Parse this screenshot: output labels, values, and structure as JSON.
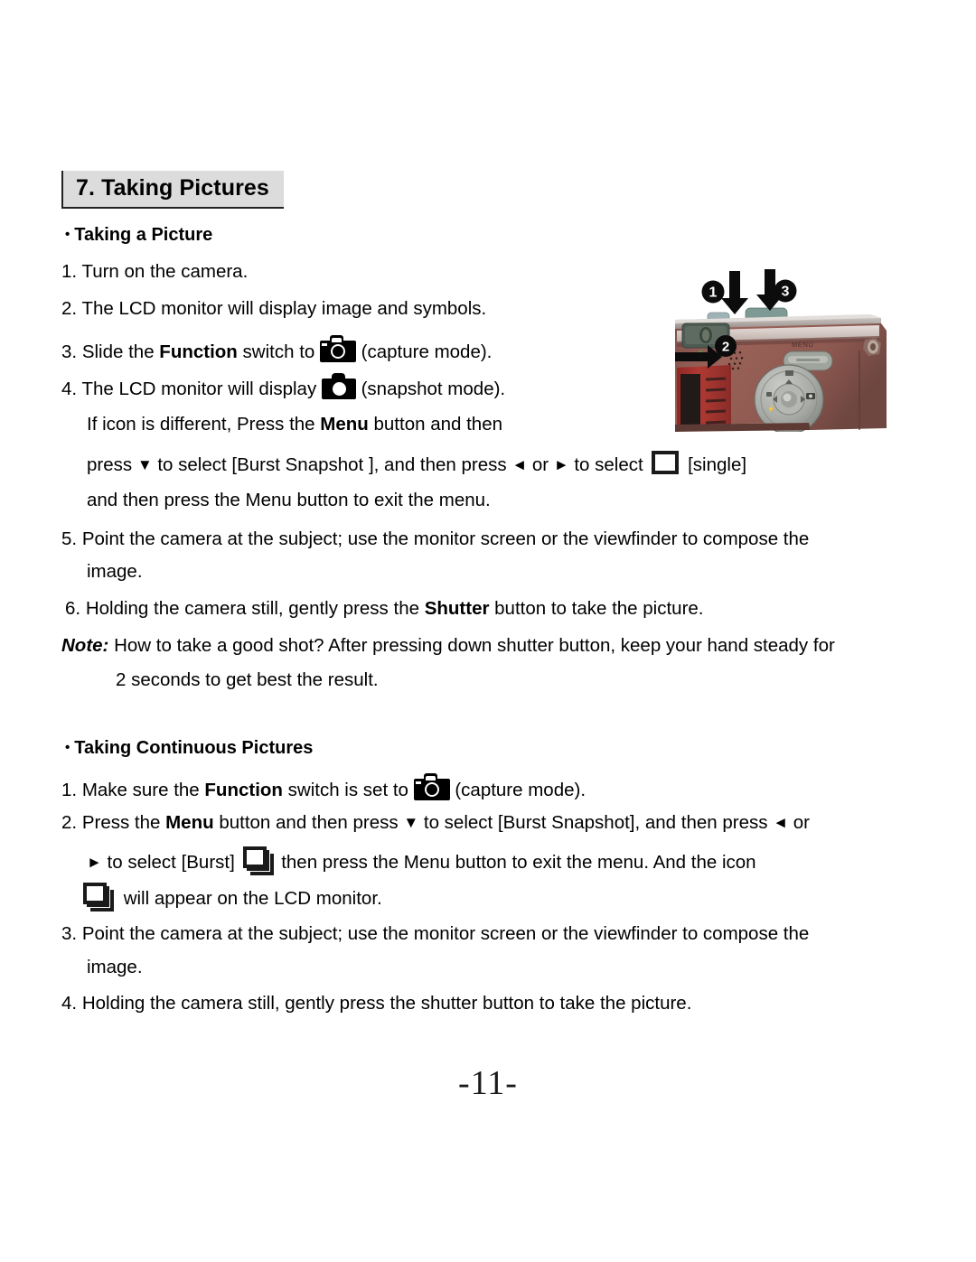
{
  "document": {
    "section_header": "7. Taking Pictures",
    "page_number": "-11-"
  },
  "sections": [
    {
      "heading": "Taking a Picture",
      "bullet": "•",
      "steps": [
        {
          "num": "1.",
          "text": "Turn on the camera."
        },
        {
          "num": "2.",
          "text": "The LCD monitor will display image and symbols."
        },
        {
          "num": "3.",
          "pre": "Slide the ",
          "bold": "Function",
          "mid": " switch to ",
          "icon": "camera-outline-icon",
          "post": " (capture mode)."
        },
        {
          "num": "4.",
          "pre": "The LCD monitor will display ",
          "icon": "camera-solid-icon",
          "post": " (snapshot mode)."
        }
      ],
      "step4_cont_1_pre": "If icon is different, Press the ",
      "step4_cont_1_bold": "Menu",
      "step4_cont_1_post": " button and then",
      "step4_cont_2_a": "press ",
      "step4_cont_2_down": "▼",
      "step4_cont_2_b": " to select [Burst Snapshot ], and then press ",
      "step4_cont_2_left": "◄",
      "step4_cont_2_c": " or ",
      "step4_cont_2_right": "►",
      "step4_cont_2_d": " to select ",
      "step4_cont_2_icon": "frame-single-icon",
      "step4_cont_2_e": " [single]",
      "step4_cont_3": "and then press the Menu button to exit the menu.",
      "step5_num": "5.",
      "step5_line1": "Point the camera at the subject; use the monitor screen or the viewfinder to compose the",
      "step5_line2": "image.",
      "step6_num": "6.",
      "step6_pre": "Holding the camera still, gently press the ",
      "step6_bold": "Shutter",
      "step6_post": " button to take the picture.",
      "note_label": "Note:",
      "note_line1": " How to take a good shot? After pressing down shutter button, keep your hand steady for",
      "note_line2": "2 seconds to get best the result."
    },
    {
      "heading": "Taking Continuous Pictures",
      "bullet": "•",
      "c_step1_num": "1.",
      "c_step1_pre": "Make sure the ",
      "c_step1_bold": "Function",
      "c_step1_mid": " switch is set to ",
      "c_step1_icon": "camera-outline-icon",
      "c_step1_post": " (capture mode).",
      "c_step2_num": "2.",
      "c_step2_pre": "Press the ",
      "c_step2_bold": "Menu",
      "c_step2_mid": " button and then press ",
      "c_step2_down": "▼",
      "c_step2_mid2": " to select [Burst Snapshot], and then press ",
      "c_step2_left": "◄",
      "c_step2_post": " or",
      "c_step2_l2_right": "►",
      "c_step2_l2_a": " to select [Burst] ",
      "c_step2_l2_icon": "frame-burst-icon",
      "c_step2_l2_b": " then press the Menu button to exit the menu. And the icon",
      "c_step2_l3_icon": "frame-burst-icon",
      "c_step2_l3_text": " will appear on the LCD monitor.",
      "c_step3_num": "3.",
      "c_step3_line1": "Point the camera at the subject; use the monitor screen or the viewfinder to compose the",
      "c_step3_line2": "image.",
      "c_step4_num": "4.",
      "c_step4_text": "Holding the camera still, gently press the shutter button to take the picture."
    }
  ],
  "figure": {
    "name": "camera-top-view-photo",
    "callouts": [
      {
        "label": "1",
        "glyph": "❶"
      },
      {
        "label": "2",
        "glyph": "❷"
      },
      {
        "label": "3",
        "glyph": "❸"
      }
    ],
    "menu_button_label": "MENU",
    "body_color": "#8c5b55",
    "panel_color": "#a0332f"
  }
}
